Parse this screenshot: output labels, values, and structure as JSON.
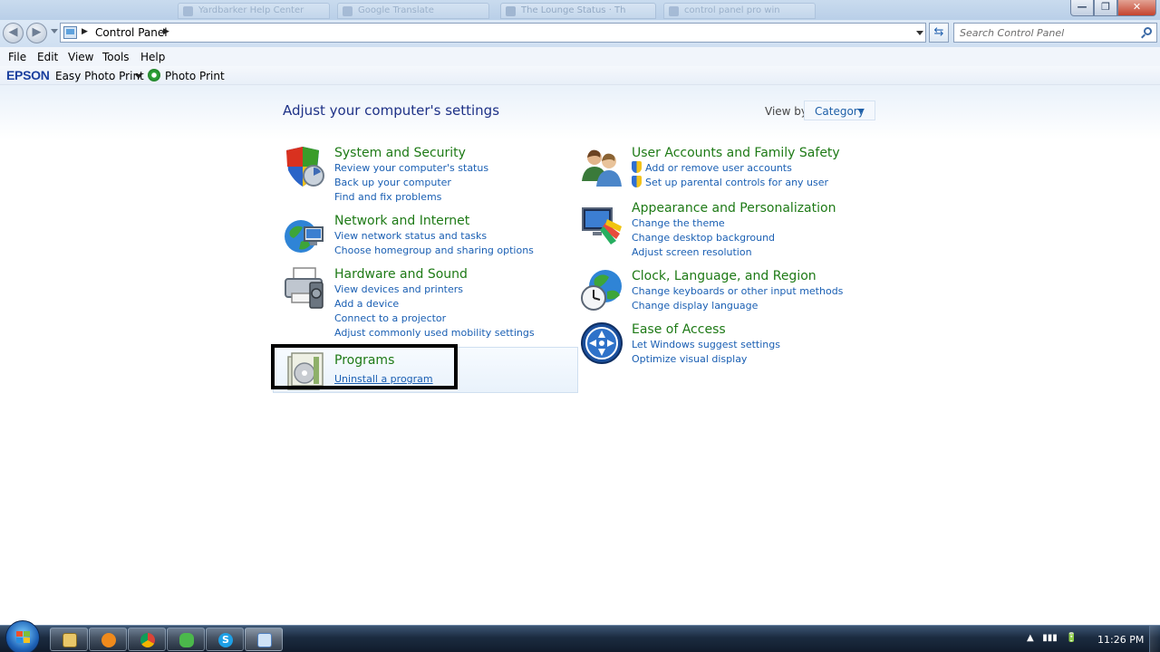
{
  "title_strip": {
    "tabs": [
      "Yardbarker Help Center",
      "Google Translate",
      "The Lounge Status · Th",
      "control panel pro win"
    ]
  },
  "window_controls": {
    "minimize": "—",
    "maximize": "❐",
    "close": "✕"
  },
  "address_bar": {
    "path": [
      "Control Panel"
    ],
    "search_placeholder": "Search Control Panel"
  },
  "menu": [
    "File",
    "Edit",
    "View",
    "Tools",
    "Help"
  ],
  "epson_toolbar": {
    "logo": "EPSON",
    "easy_photo_print": "Easy Photo Print",
    "photo_print": "Photo Print"
  },
  "main": {
    "heading": "Adjust your computer's settings",
    "view_by_label": "View by:",
    "view_by_value": "Category"
  },
  "categories": {
    "system_security": {
      "title": "System and Security",
      "links": [
        "Review your computer's status",
        "Back up your computer",
        "Find and fix problems"
      ]
    },
    "network_internet": {
      "title": "Network and Internet",
      "links": [
        "View network status and tasks",
        "Choose homegroup and sharing options"
      ]
    },
    "hardware_sound": {
      "title": "Hardware and Sound",
      "links": [
        "View devices and printers",
        "Add a device",
        "Connect to a projector",
        "Adjust commonly used mobility settings"
      ]
    },
    "programs": {
      "title": "Programs",
      "links": [
        "Uninstall a program"
      ]
    },
    "user_accounts": {
      "title": "User Accounts and Family Safety",
      "links": [
        "Add or remove user accounts",
        "Set up parental controls for any user"
      ]
    },
    "appearance": {
      "title": "Appearance and Personalization",
      "links": [
        "Change the theme",
        "Change desktop background",
        "Adjust screen resolution"
      ]
    },
    "clock_region": {
      "title": "Clock, Language, and Region",
      "links": [
        "Change keyboards or other input methods",
        "Change display language"
      ]
    },
    "ease_access": {
      "title": "Ease of Access",
      "links": [
        "Let Windows suggest settings",
        "Optimize visual display"
      ]
    }
  },
  "taskbar": {
    "pinned": [
      "windows-explorer",
      "media-player",
      "chrome",
      "games",
      "skype",
      "control-panel"
    ],
    "clock": "11:26 PM"
  },
  "colors": {
    "heading": "#1e3287",
    "category_title": "#1e7a16",
    "link": "#1a5fb3"
  }
}
